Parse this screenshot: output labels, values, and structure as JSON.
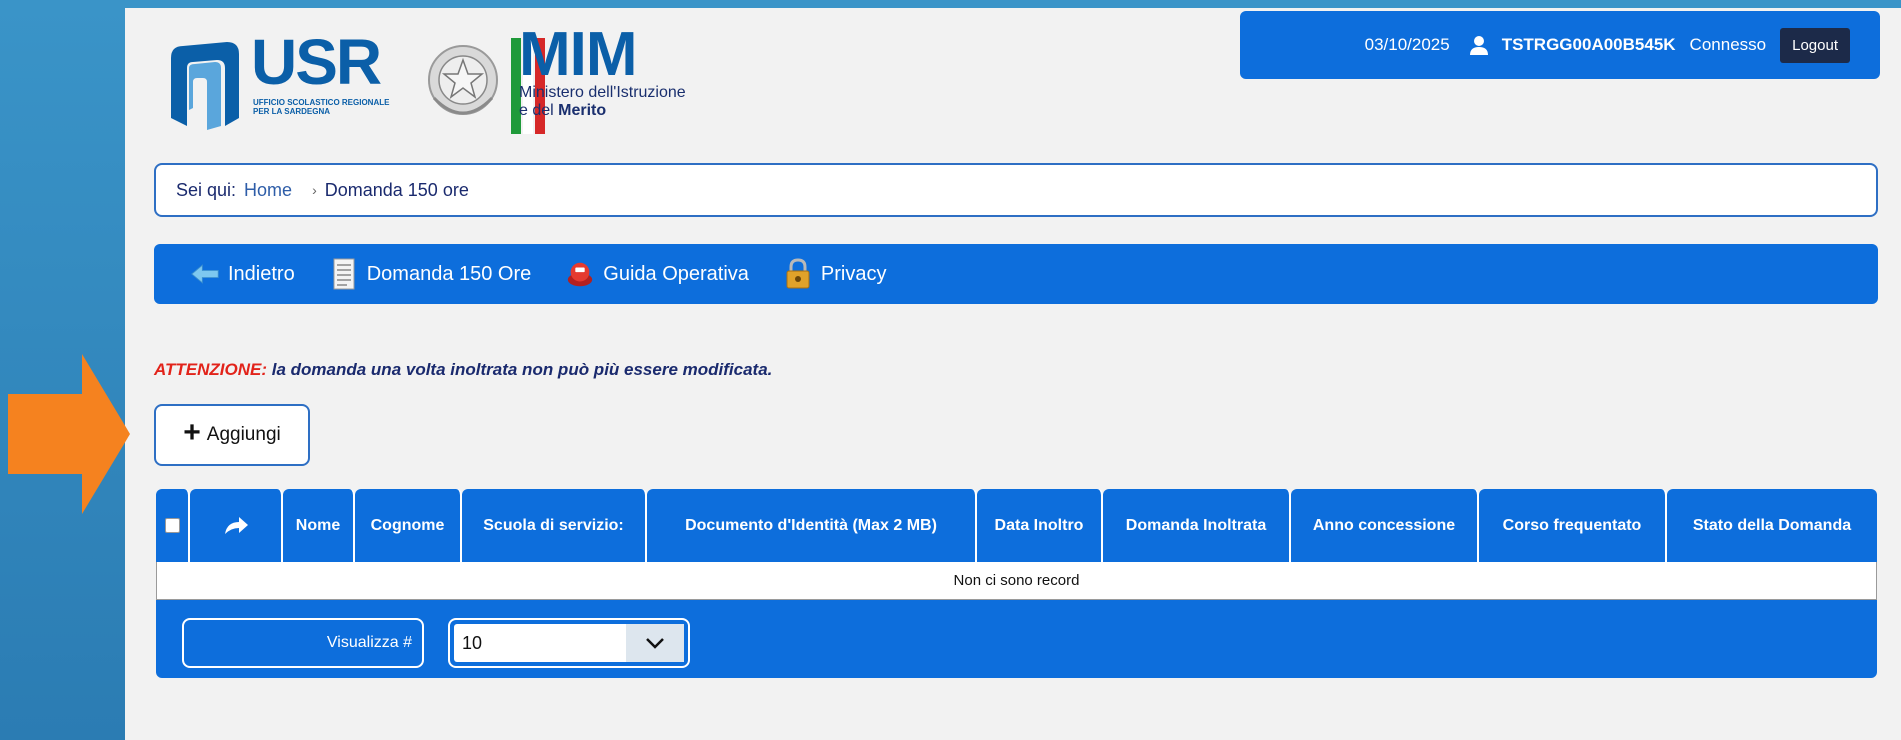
{
  "header": {
    "usr_logo": {
      "title": "USR",
      "subtitle": "UFFICIO SCOLASTICO REGIONALE PER LA SARDEGNA"
    },
    "mim_logo": {
      "title": "MIM",
      "line1": "Ministero dell'Istruzione",
      "line2_pre": "e del ",
      "line2_bold": "Merito"
    }
  },
  "userbox": {
    "date": "03/10/2025",
    "user_id": "TSTRGG00A00B545K",
    "status": "Connesso",
    "logout_label": "Logout"
  },
  "breadcrumb": {
    "prefix": "Sei qui:",
    "home": "Home",
    "separator": "›",
    "current": "Domanda 150 ore"
  },
  "toolbar": {
    "items": [
      {
        "label": "Indietro",
        "icon": "back-arrow-icon"
      },
      {
        "label": "Domanda 150 Ore",
        "icon": "document-icon"
      },
      {
        "label": "Guida Operativa",
        "icon": "help-lifebuoy-icon"
      },
      {
        "label": "Privacy",
        "icon": "lock-icon"
      }
    ]
  },
  "warning": {
    "label": "ATTENZIONE:",
    "text": " la domanda una volta inoltrata non può più essere modificata."
  },
  "add_button": {
    "label": "Aggiungi"
  },
  "table": {
    "columns": [
      "Nome",
      "Cognome",
      "Scuola di servizio:",
      "Documento d'Identità (Max 2 MB)",
      "Data Inoltro",
      "Domanda Inoltrata",
      "Anno concessione",
      "Corso frequentato",
      "Stato della Domanda"
    ],
    "empty_message": "Non ci sono record",
    "page_size_label": "Visualizza #",
    "page_size_value": "10"
  },
  "colors": {
    "primary_blue": "#0d6edc",
    "warning_red": "#e2231a",
    "arrow_orange": "#f5821f"
  }
}
